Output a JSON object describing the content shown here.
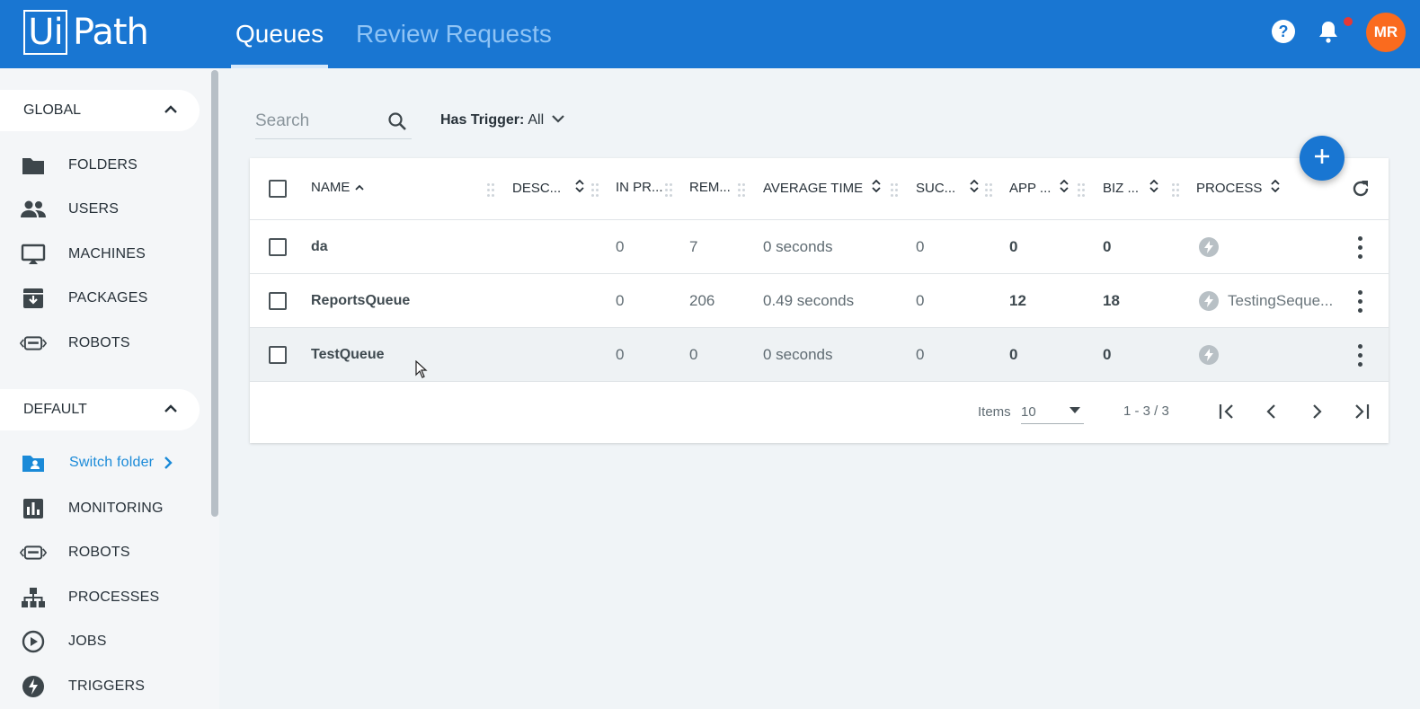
{
  "header": {
    "logo": {
      "boxed": "Ui",
      "rest": "Path"
    },
    "tabs": [
      {
        "label": "Queues",
        "active": true
      },
      {
        "label": "Review Requests",
        "active": false
      }
    ],
    "avatar_initials": "MR",
    "accent": "#1976d2",
    "avatar_color": "#fa6b1e"
  },
  "sidebar": {
    "global_label": "GLOBAL",
    "global_items": [
      "FOLDERS",
      "USERS",
      "MACHINES",
      "PACKAGES",
      "ROBOTS"
    ],
    "default_label": "DEFAULT",
    "switch_folder": "Switch folder",
    "default_items": [
      "MONITORING",
      "ROBOTS",
      "PROCESSES",
      "JOBS",
      "TRIGGERS"
    ]
  },
  "toolbar": {
    "search_placeholder": "Search",
    "filter_label": "Has Trigger:",
    "filter_value": "All"
  },
  "table": {
    "columns": [
      "NAME",
      "DESC...",
      "IN PR...",
      "REM...",
      "AVERAGE TIME",
      "SUC...",
      "APP ...",
      "BIZ ...",
      "PROCESS"
    ],
    "rows": [
      {
        "name": "da",
        "in_progress": "0",
        "remaining": "7",
        "avg_time": "0 seconds",
        "successful": "0",
        "app_exc": "0",
        "biz_exc": "0",
        "process": ""
      },
      {
        "name": "ReportsQueue",
        "in_progress": "0",
        "remaining": "206",
        "avg_time": "0.49 seconds",
        "successful": "0",
        "app_exc": "12",
        "biz_exc": "18",
        "process": "TestingSeque..."
      },
      {
        "name": "TestQueue",
        "in_progress": "0",
        "remaining": "0",
        "avg_time": "0 seconds",
        "successful": "0",
        "app_exc": "0",
        "biz_exc": "0",
        "process": ""
      }
    ]
  },
  "pager": {
    "items_label": "Items",
    "page_size": "10",
    "range": "1 - 3 / 3"
  }
}
